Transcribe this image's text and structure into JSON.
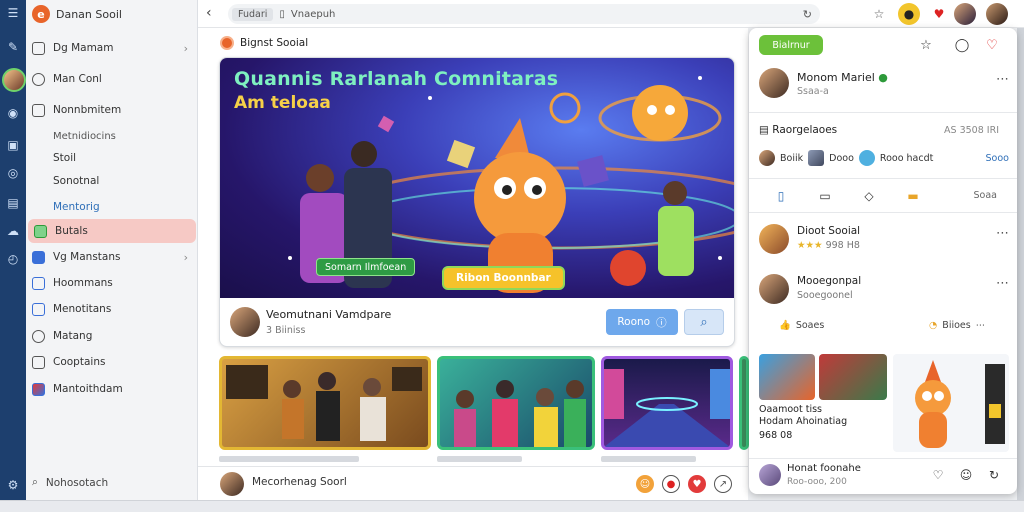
{
  "rail": {
    "icons": [
      "menu-icon",
      "wrench-icon",
      "user-icon",
      "person-icon",
      "bookmark-icon",
      "compass-icon",
      "layers-icon",
      "cloud-icon",
      "clock-icon",
      "settings-icon"
    ]
  },
  "sidebar": {
    "brand": "Danan Sooil",
    "items": [
      {
        "label": "Dg Mamam",
        "chevron": true
      },
      {
        "label": "Man Conl",
        "chevron": false
      },
      {
        "label": "Nonnbmitem",
        "chevron": false
      },
      {
        "label": "Metnidiocins",
        "chevron": false
      },
      {
        "label": "Stoil",
        "chevron": false
      },
      {
        "label": "Sonotnal",
        "chevron": false
      },
      {
        "label": "Mentorig",
        "chevron": false
      },
      {
        "label": "Butals",
        "chevron": false
      },
      {
        "label": "Vg Manstans",
        "chevron": true
      },
      {
        "label": "Hoommans",
        "chevron": false
      },
      {
        "label": "Menotitans",
        "chevron": false
      },
      {
        "label": "Matang",
        "chevron": false
      },
      {
        "label": "Cooptains",
        "chevron": false
      },
      {
        "label": "Mantoithdam",
        "chevron": false
      }
    ],
    "footer": "Nohosotach"
  },
  "browser": {
    "tab_label": "Fudari",
    "url": "Vnaepuh"
  },
  "main": {
    "page_title": "Bignst Sooial",
    "hero": {
      "title_line1": "Quannis Rarlanah Comnitaras",
      "title_line2": "Am teloaa",
      "badge": "Somarn Ilmfoean",
      "cta": "Ribon Boonnbar"
    },
    "post": {
      "author": "Veomutnani Vamdpare",
      "meta": "3 Biiniss",
      "follow_label": "Roono"
    },
    "bottom_text": "Mecorhenag Soorl"
  },
  "panel": {
    "pill": "Bialrnur",
    "profile": {
      "name": "Monom Mariel",
      "sub": "Ssaa-a"
    },
    "section_title": "Raorgelaoes",
    "section_right": "AS 3508 IRI",
    "mini_row": {
      "a": "Boiik",
      "b": "Dooo",
      "c": "Rooo hacdt",
      "count": "Sooo"
    },
    "tabs_more": "Soaa",
    "users": [
      {
        "name": "Dioot Sooial",
        "sub": "998 H8"
      },
      {
        "name": "Mooegonpal",
        "sub": "Sooegoonel"
      }
    ],
    "actions": {
      "like": "Soaes",
      "share": "Biioes"
    },
    "thumb_caption": {
      "line1": "Oaamoot tiss",
      "line2": "Hodam Ahoinatiag",
      "line3": "968 08"
    },
    "footer": {
      "name": "Honat foonahe",
      "sub": "Roo-ooo, 200"
    }
  }
}
